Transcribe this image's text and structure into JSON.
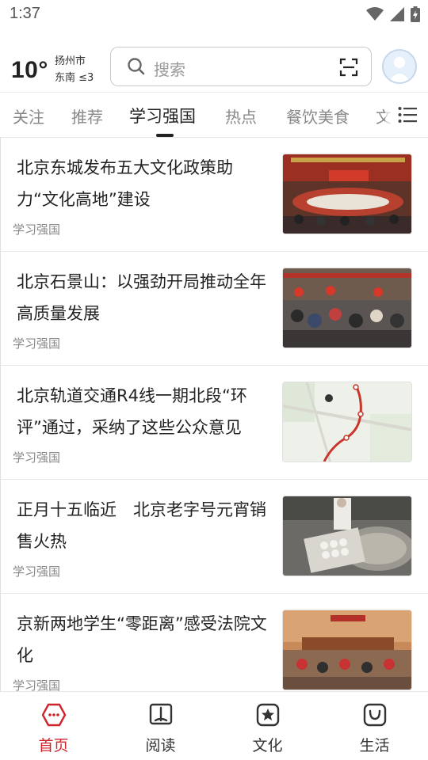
{
  "status_bar": {
    "time": "1:37"
  },
  "weather": {
    "temperature": "10°",
    "city": "扬州市",
    "wind": "东南 ≤3"
  },
  "search": {
    "placeholder": "搜索"
  },
  "tabs": [
    {
      "label": "关注"
    },
    {
      "label": "推荐"
    },
    {
      "label": "学习强国",
      "active": true
    },
    {
      "label": "热点"
    },
    {
      "label": "餐饮美食"
    },
    {
      "label": "文"
    }
  ],
  "news": [
    {
      "title": "北京东城发布五大文化政策助力“文化高地”建设",
      "source": "学习强国",
      "thumb_icon": "conference-hall-photo"
    },
    {
      "title": "北京石景山：以强劲开局推动全年高质量发展",
      "source": "学习强国",
      "thumb_icon": "crowd-street-photo"
    },
    {
      "title": "北京轨道交通R4线一期北段“环评”通过，采纳了这些公众意见",
      "source": "学习强国",
      "thumb_icon": "metro-map-photo"
    },
    {
      "title": "正月十五临近　北京老字号元宵销售火热",
      "source": "学习强国",
      "thumb_icon": "yuanxiao-making-photo"
    },
    {
      "title": "京新两地学生“零距离”感受法院文化",
      "source": "学习强国",
      "thumb_icon": "courtroom-photo"
    }
  ],
  "bottom_nav": [
    {
      "label": "首页",
      "icon": "home-icon",
      "active": true
    },
    {
      "label": "阅读",
      "icon": "book-icon"
    },
    {
      "label": "文化",
      "icon": "star-box-icon"
    },
    {
      "label": "生活",
      "icon": "smile-bag-icon"
    }
  ],
  "colors": {
    "accent": "#d0242c",
    "text": "#222222",
    "muted": "#888888"
  }
}
